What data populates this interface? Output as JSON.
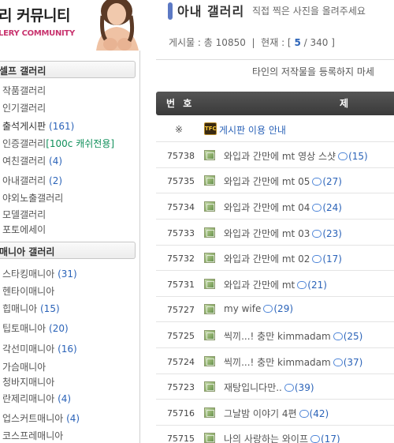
{
  "logo": {
    "title": "리 커뮤니티",
    "subtitle": "LERY COMMUNITY"
  },
  "sidebar": {
    "self_gallery": {
      "heading": "셀프 갤러리",
      "items": [
        {
          "label": "작품갤러리",
          "count": ""
        },
        {
          "label": "인기갤러리",
          "count": ""
        },
        {
          "label": "출석게시판",
          "count": "(161)"
        },
        {
          "label": "인증갤러리",
          "count": "",
          "extra": "[100c 캐쉬전용]"
        },
        {
          "label": "여친갤러리",
          "count": "(4)"
        },
        {
          "label": "아내갤러리",
          "count": "(2)"
        },
        {
          "label": "야외노출갤러리",
          "count": ""
        },
        {
          "label": "모델갤러리",
          "count": ""
        },
        {
          "label": "포토에세이",
          "count": ""
        }
      ]
    },
    "mania_gallery": {
      "heading": "매니아 갤러리",
      "items": [
        {
          "label": "스타킹매니아",
          "count": "(31)"
        },
        {
          "label": "헨타이매니아",
          "count": ""
        },
        {
          "label": "힙매니아",
          "count": "(15)"
        },
        {
          "label": "팁토매니아",
          "count": "(20)"
        },
        {
          "label": "각선미매니아",
          "count": "(16)"
        },
        {
          "label": "가슴매니아",
          "count": ""
        },
        {
          "label": "청바지매니아",
          "count": ""
        },
        {
          "label": "란제리매니아",
          "count": "(4)"
        },
        {
          "label": "업스커트매니아",
          "count": "(4)"
        },
        {
          "label": "코스프레매니아",
          "count": ""
        }
      ]
    }
  },
  "board": {
    "title": "아내 갤러리",
    "description": "직접 찍은 사진을 올려주세요",
    "stats": {
      "total_label": "게시물 : 총",
      "total": "10850",
      "page_label": "현재 : [",
      "current_page": "5",
      "total_pages": "340",
      "page_end": "]"
    },
    "notice_text": "타인의 저작물을 등록하지 마세",
    "columns": {
      "number": "번 호",
      "title": "제"
    },
    "notice_row": {
      "mark": "※",
      "icon_text": "TFC",
      "title": "게시판 이용 안내"
    },
    "posts": [
      {
        "number": "75738",
        "title": "와입과 간만에 mt 영상 스샷",
        "comments": "(15)"
      },
      {
        "number": "75735",
        "title": "와입과 간만에 mt 05",
        "comments": "(27)"
      },
      {
        "number": "75734",
        "title": "와입과 간만에 mt 04",
        "comments": "(24)"
      },
      {
        "number": "75733",
        "title": "와입과 간만에 mt 03",
        "comments": "(23)"
      },
      {
        "number": "75732",
        "title": "와입과 간만에 mt 02",
        "comments": "(17)"
      },
      {
        "number": "75731",
        "title": "와입과 간만에 mt",
        "comments": "(21)"
      },
      {
        "number": "75727",
        "title": "my wife",
        "comments": "(29)"
      },
      {
        "number": "75725",
        "title": "씩끼...! 충만 kimmadam",
        "comments": "(25)"
      },
      {
        "number": "75724",
        "title": "씩끼...! 충만 kimmadam",
        "comments": "(37)"
      },
      {
        "number": "75723",
        "title": "재탕입니다만..",
        "comments": "(39)"
      },
      {
        "number": "75716",
        "title": "그날밤 이야기 4편",
        "comments": "(42)"
      },
      {
        "number": "75715",
        "title": "나의 사랑하는 와이프",
        "comments": "(17)"
      }
    ]
  },
  "colors": {
    "accent_blue": "#2b63b8",
    "title_bar": "#5c79c4",
    "header_dark": "#444444",
    "brand_pink": "#c8336e",
    "green_text": "#0f8f5a"
  }
}
